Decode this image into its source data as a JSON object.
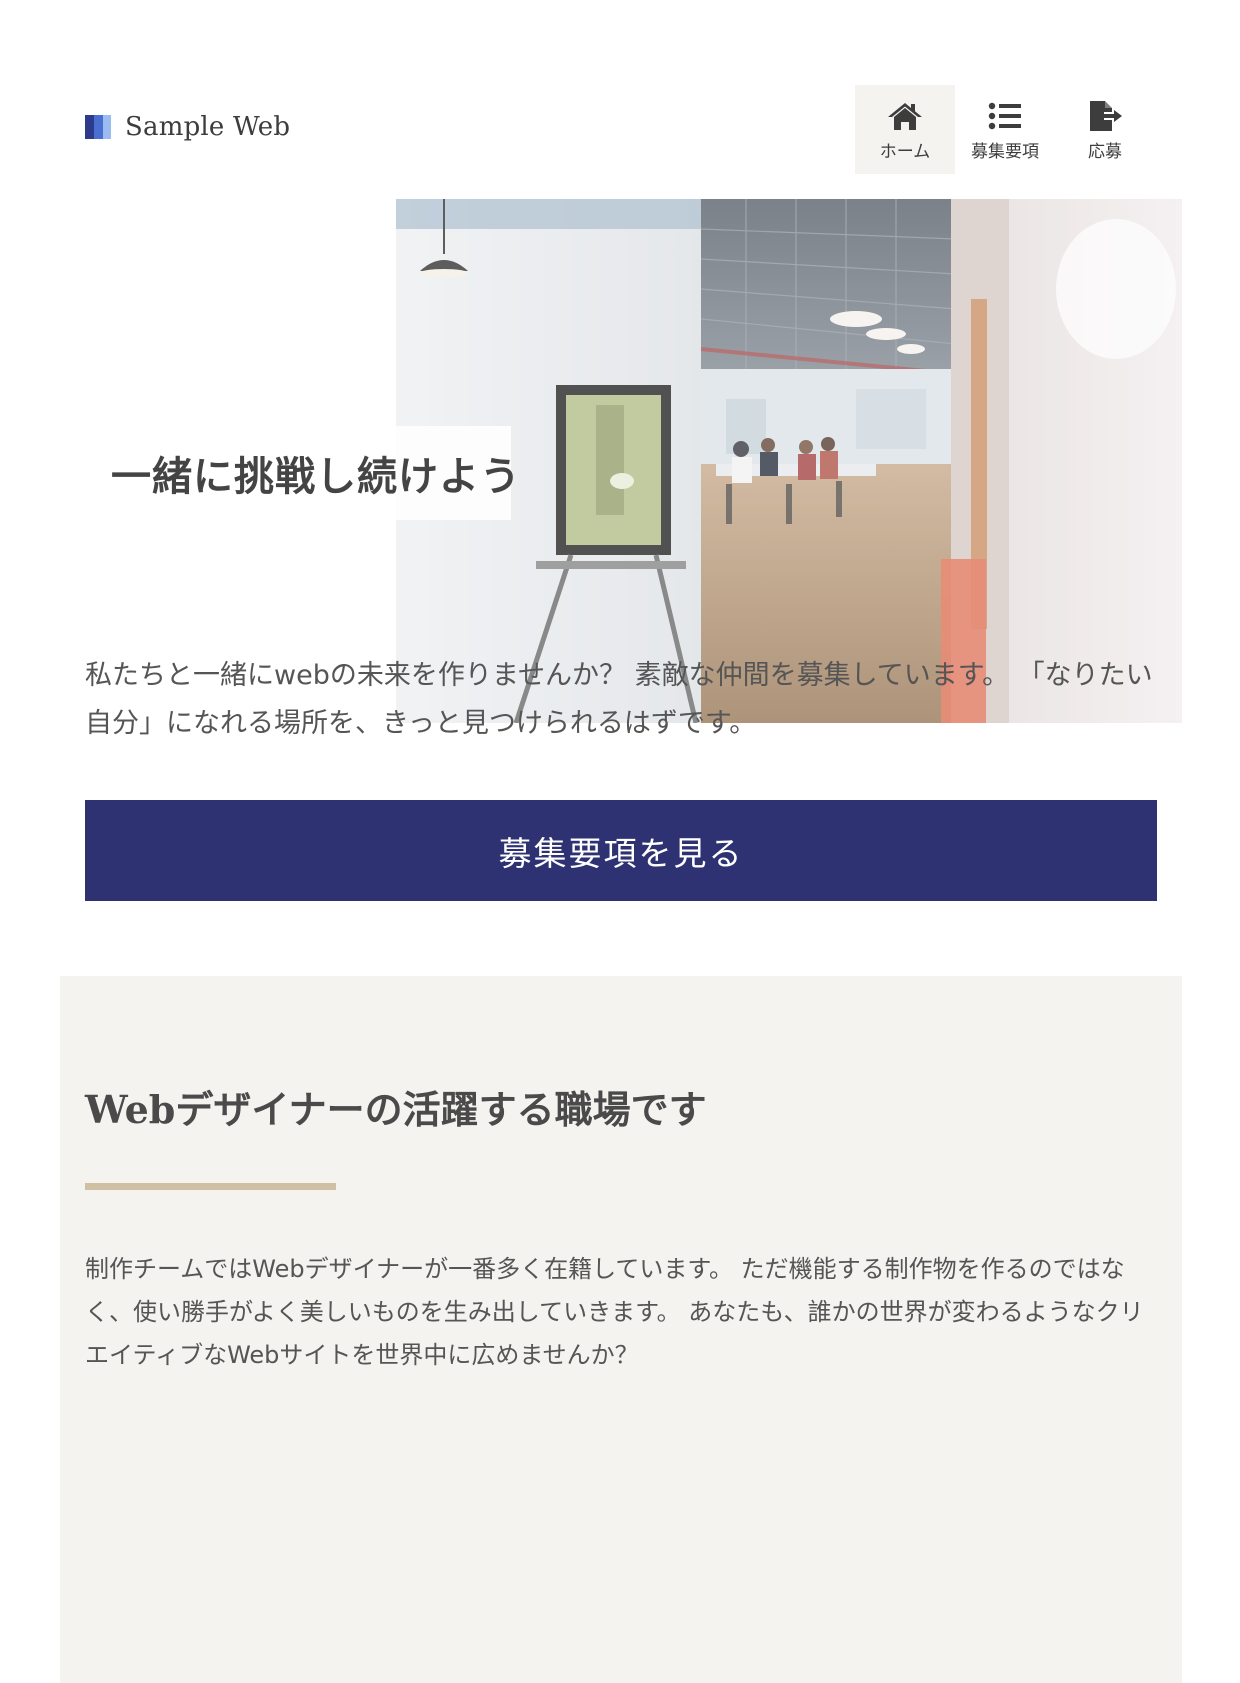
{
  "header": {
    "logo_text": "Sample Web",
    "logo_colors": [
      "#2e3b8c",
      "#4a6fd1",
      "#9bbcf0"
    ],
    "nav": [
      {
        "label": "ホーム",
        "icon": "home-icon",
        "active": true
      },
      {
        "label": "募集要項",
        "icon": "list-icon",
        "active": false
      },
      {
        "label": "応募",
        "icon": "file-export-icon",
        "active": false
      }
    ]
  },
  "hero": {
    "title": "一緒に挑戦し続けよう",
    "text": "私たちと一緒にwebの未来を作りませんか？ 素敵な仲間を募集しています。 「なりたい自分」になれる場所を、きっと見つけられるはずです。",
    "cta_label": "募集要項を見る",
    "photo_icon": "office-photo"
  },
  "section": {
    "title": "Webデザイナーの活躍する職場です",
    "text": "制作チームではWebデザイナーが一番多く在籍しています。 ただ機能する制作物を作るのではなく、使い勝手がよく美しいものを生み出していきます。 あなたも、誰かの世界が変わるようなクリエイティブなWebサイトを世界中に広めませんか？"
  },
  "colors": {
    "accent": "#2e3172",
    "section_bg": "#f4f3f0",
    "rule": "#cfbfa3",
    "text": "#555555"
  }
}
